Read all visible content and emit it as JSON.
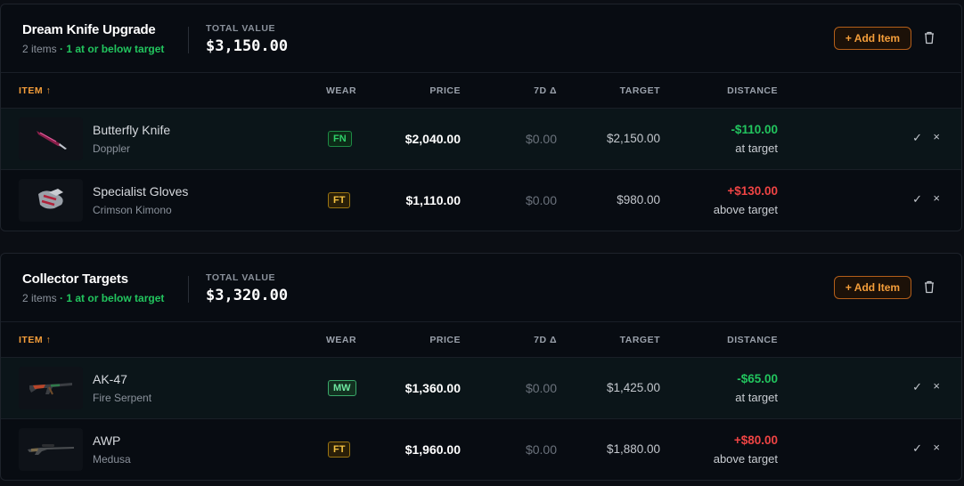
{
  "common": {
    "total_value_label": "TOTAL VALUE",
    "add_item_label": "+ Add Item",
    "columns": {
      "item": "ITEM ↑",
      "wear": "WEAR",
      "price": "PRICE",
      "d7": "7D Δ",
      "target": "TARGET",
      "distance": "DISTANCE"
    },
    "check_glyph": "✓",
    "remove_glyph": "×"
  },
  "lists": [
    {
      "title": "Dream Knife Upgrade",
      "count": "2 items",
      "status": "· 1 at or below target",
      "total_value": "$3,150.00",
      "items": [
        {
          "name": "Butterfly Knife",
          "variant": "Doppler",
          "wear": "FN",
          "price": "$2,040.00",
          "d7": "$0.00",
          "target": "$2,150.00",
          "distance": "-$110.00",
          "distance_note": "at target",
          "icon": "butterfly-knife-icon"
        },
        {
          "name": "Specialist Gloves",
          "variant": "Crimson Kimono",
          "wear": "FT",
          "price": "$1,110.00",
          "d7": "$0.00",
          "target": "$980.00",
          "distance": "+$130.00",
          "distance_note": "above target",
          "icon": "gloves-icon"
        }
      ]
    },
    {
      "title": "Collector Targets",
      "count": "2 items",
      "status": "· 1 at or below target",
      "total_value": "$3,320.00",
      "items": [
        {
          "name": "AK-47",
          "variant": "Fire Serpent",
          "wear": "MW",
          "price": "$1,360.00",
          "d7": "$0.00",
          "target": "$1,425.00",
          "distance": "-$65.00",
          "distance_note": "at target",
          "icon": "rifle-icon"
        },
        {
          "name": "AWP",
          "variant": "Medusa",
          "wear": "FT",
          "price": "$1,960.00",
          "d7": "$0.00",
          "target": "$1,880.00",
          "distance": "+$80.00",
          "distance_note": "above target",
          "icon": "sniper-rifle-icon"
        }
      ]
    }
  ],
  "colors": {
    "accent": "#f59e3a",
    "good": "#22c55e",
    "bad": "#ef4444",
    "background": "#080c12"
  }
}
